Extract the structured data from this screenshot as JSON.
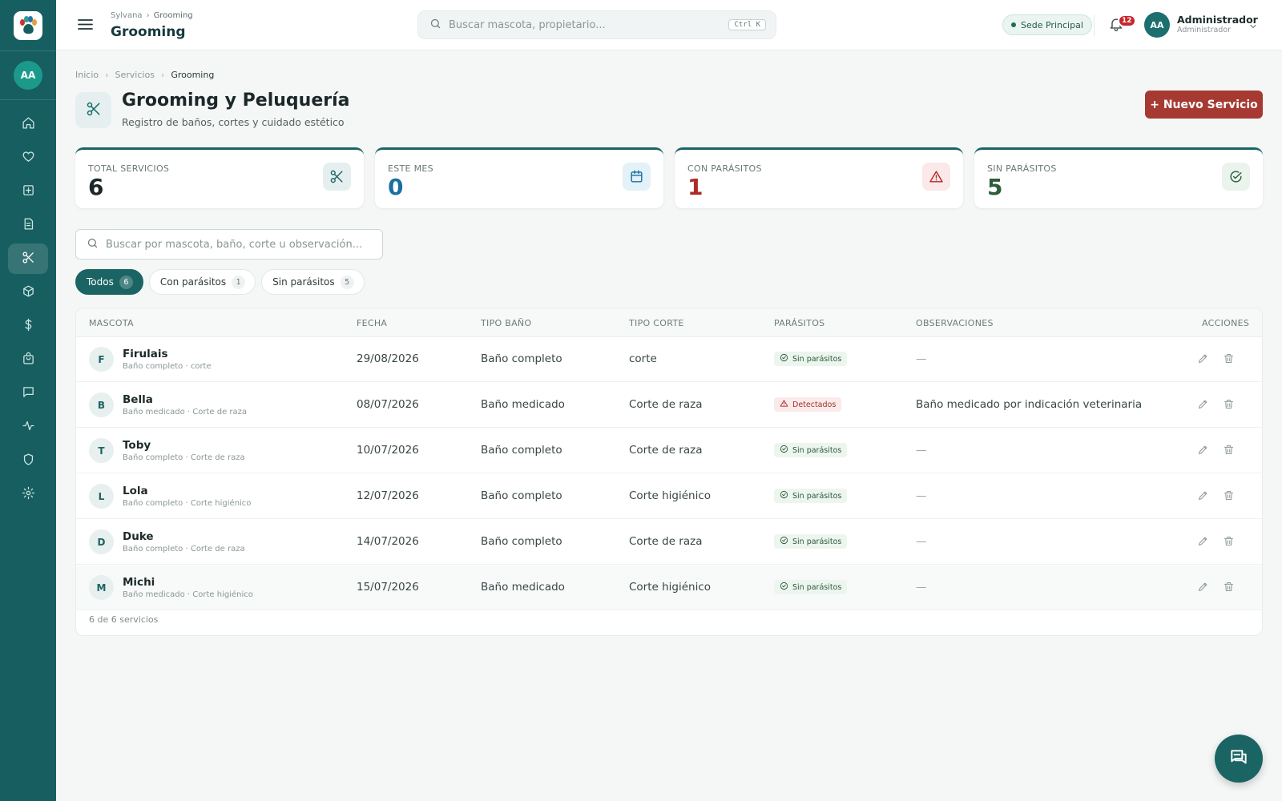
{
  "app": {
    "brand_icon": "paw-icon",
    "user_initials": "AA"
  },
  "sidebar": {
    "avatar": "AA",
    "items": [
      {
        "name": "home",
        "icon": "home-icon"
      },
      {
        "name": "heart",
        "icon": "heart-icon"
      },
      {
        "name": "medical",
        "icon": "plus-square-icon"
      },
      {
        "name": "records",
        "icon": "document-icon"
      },
      {
        "name": "grooming",
        "icon": "scissors-icon",
        "active": true
      },
      {
        "name": "inventory",
        "icon": "box-icon"
      },
      {
        "name": "billing",
        "icon": "dollar-icon"
      },
      {
        "name": "shop",
        "icon": "bag-icon"
      },
      {
        "name": "messages",
        "icon": "chat-icon"
      },
      {
        "name": "activity",
        "icon": "pulse-icon"
      },
      {
        "name": "security",
        "icon": "shield-icon"
      },
      {
        "name": "settings",
        "icon": "gear-icon"
      }
    ]
  },
  "header": {
    "breadcrumb": [
      "Sylvana",
      "Grooming"
    ],
    "title": "Grooming",
    "search_placeholder": "Buscar mascota, propietario...",
    "shortcut": "Ctrl K",
    "branch": "Sede Principal",
    "notifications": "12",
    "user_initials": "AA",
    "user_name": "Administrador",
    "user_role": "Administrador"
  },
  "page": {
    "breadcrumb": [
      "Inicio",
      "Servicios",
      "Grooming"
    ],
    "title": "Grooming y Peluquería",
    "subtitle": "Registro de baños, cortes y cuidado estético",
    "new_button": "+ Nuevo Servicio"
  },
  "stats": [
    {
      "label": "TOTAL SERVICIOS",
      "value": "6",
      "color": "#1c2727",
      "icon": "scissors-icon",
      "icon_bg": "#e6efef",
      "icon_color": "#1b6464"
    },
    {
      "label": "ESTE MES",
      "value": "0",
      "color": "#1a6fa0",
      "icon": "calendar-icon",
      "icon_bg": "#e3f1f8",
      "icon_color": "#1a6fa0"
    },
    {
      "label": "CON PARÁSITOS",
      "value": "1",
      "color": "#b02a2a",
      "icon": "warning-icon",
      "icon_bg": "#fbe8e8",
      "icon_color": "#b02a2a"
    },
    {
      "label": "SIN PARÁSITOS",
      "value": "5",
      "color": "#2d5c3a",
      "icon": "check-circle-icon",
      "icon_bg": "#eaf3ec",
      "icon_color": "#2d5c3a"
    }
  ],
  "search": {
    "placeholder": "Buscar por mascota, baño, corte u observación..."
  },
  "filters": [
    {
      "label": "Todos",
      "count": "6",
      "active": true
    },
    {
      "label": "Con parásitos",
      "count": "1",
      "active": false
    },
    {
      "label": "Sin parásitos",
      "count": "5",
      "active": false
    }
  ],
  "table": {
    "columns": [
      "MASCOTA",
      "FECHA",
      "TIPO BAÑO",
      "TIPO CORTE",
      "PARÁSITOS",
      "OBSERVACIONES",
      "ACCIONES"
    ],
    "rows": [
      {
        "initial": "F",
        "name": "Firulais",
        "sub": "Baño completo · corte",
        "date": "29/08/2026",
        "bath": "Baño completo",
        "cut": "corte",
        "parasites": "Sin parásitos",
        "detected": false,
        "notes": "—"
      },
      {
        "initial": "B",
        "name": "Bella",
        "sub": "Baño medicado · Corte de raza",
        "date": "08/07/2026",
        "bath": "Baño medicado",
        "cut": "Corte de raza",
        "parasites": "Detectados",
        "detected": true,
        "notes": "Baño medicado por indicación veterinaria"
      },
      {
        "initial": "T",
        "name": "Toby",
        "sub": "Baño completo · Corte de raza",
        "date": "10/07/2026",
        "bath": "Baño completo",
        "cut": "Corte de raza",
        "parasites": "Sin parásitos",
        "detected": false,
        "notes": "—"
      },
      {
        "initial": "L",
        "name": "Lola",
        "sub": "Baño completo · Corte higiénico",
        "date": "12/07/2026",
        "bath": "Baño completo",
        "cut": "Corte higiénico",
        "parasites": "Sin parásitos",
        "detected": false,
        "notes": "—"
      },
      {
        "initial": "D",
        "name": "Duke",
        "sub": "Baño completo · Corte de raza",
        "date": "14/07/2026",
        "bath": "Baño completo",
        "cut": "Corte de raza",
        "parasites": "Sin parásitos",
        "detected": false,
        "notes": "—"
      },
      {
        "initial": "M",
        "name": "Michi",
        "sub": "Baño medicado · Corte higiénico",
        "date": "15/07/2026",
        "bath": "Baño medicado",
        "cut": "Corte higiénico",
        "parasites": "Sin parásitos",
        "detected": false,
        "notes": "—"
      }
    ],
    "footer": "6 de 6 servicios"
  },
  "fab": {
    "icon": "chat-bubbles-icon"
  }
}
